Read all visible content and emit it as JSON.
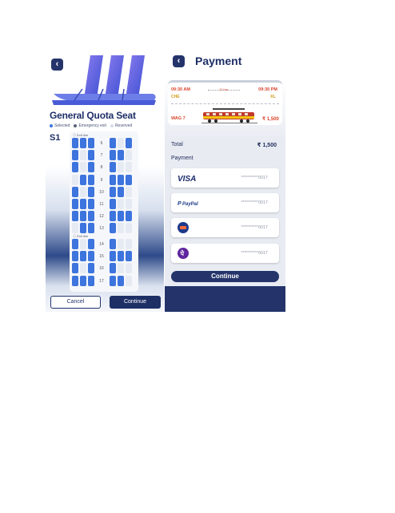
{
  "seat_screen": {
    "title": "General Quota Seat",
    "legend": {
      "selected": "Selected",
      "emergency": "Emergency exit",
      "reserved": "Reserved",
      "selected_color": "#3d74dd",
      "emergency_color": "#5a6478",
      "reserved_color": "#d6dbe6"
    },
    "coach": "S1",
    "exit_label_1": "Exit line",
    "exit_label_2": "Exit line",
    "rows": [
      "6",
      "7",
      "8",
      "9",
      "10",
      "11",
      "12",
      "13",
      "14",
      "15",
      "16",
      "17"
    ],
    "cancel_label": "Cancel",
    "continue_label": "Continue"
  },
  "payment_screen": {
    "title": "Payment",
    "ticket": {
      "depart_time": "09:30 AM",
      "arrive_time": "09:30 PM",
      "from_code": "CHE",
      "to_code": "KL",
      "duration": "12 hrs",
      "train_name": "WAG 7",
      "price": "₹ 1,500"
    },
    "total_label": "Total",
    "total_amount": "₹ 1,500",
    "payment_label": "Payment",
    "methods": [
      {
        "name": "VISA",
        "number": "**********0017",
        "icon": "visa-icon"
      },
      {
        "name": "PayPal",
        "number": "**********0017",
        "icon": "paypal-icon"
      },
      {
        "name": "Upi",
        "number": "**********0017",
        "icon": "upi-icon"
      },
      {
        "name": "PhonePe",
        "number": "**********0017",
        "icon": "phonepe-icon"
      }
    ],
    "continue_label": "Continue"
  }
}
